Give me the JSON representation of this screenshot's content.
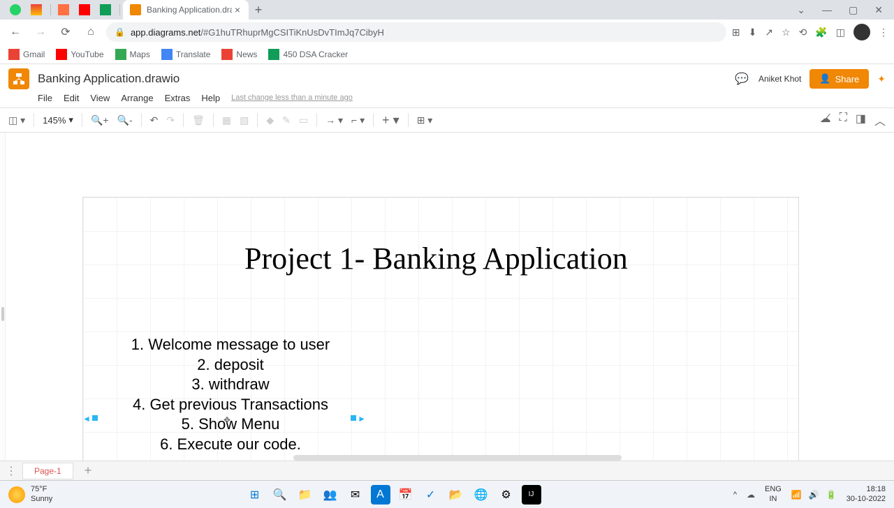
{
  "browser": {
    "tab_title": "Banking Application.drawio - dia",
    "url_host": "app.diagrams.net",
    "url_path": "/#G1huTRhuprMgCSITiKnUsDvTImJq7CibyH",
    "bookmarks": [
      {
        "label": "Gmail",
        "icon": "gmail"
      },
      {
        "label": "YouTube",
        "icon": "youtube"
      },
      {
        "label": "Maps",
        "icon": "maps"
      },
      {
        "label": "Translate",
        "icon": "translate"
      },
      {
        "label": "News",
        "icon": "news"
      },
      {
        "label": "450 DSA Cracker",
        "icon": "dsa"
      }
    ]
  },
  "app": {
    "logo": "⬢",
    "title": "Banking Application.drawio",
    "user": "Aniket Khot",
    "share_label": "Share",
    "menus": [
      "File",
      "Edit",
      "View",
      "Arrange",
      "Extras",
      "Help"
    ],
    "last_change": "Last change less than a minute ago",
    "zoom": "145%",
    "page_tab": "Page-1"
  },
  "diagram": {
    "title": "Project 1- Banking Application",
    "items": [
      "1. Welcome message to user",
      "",
      "2. deposit",
      "3. withdraw",
      "4. Get previous Transactions",
      "5. Show Menu",
      "6. Execute our code."
    ]
  },
  "system": {
    "temp": "75°F",
    "condition": "Sunny",
    "lang1": "ENG",
    "lang2": "IN",
    "time": "18:18",
    "date": "30-10-2022"
  }
}
